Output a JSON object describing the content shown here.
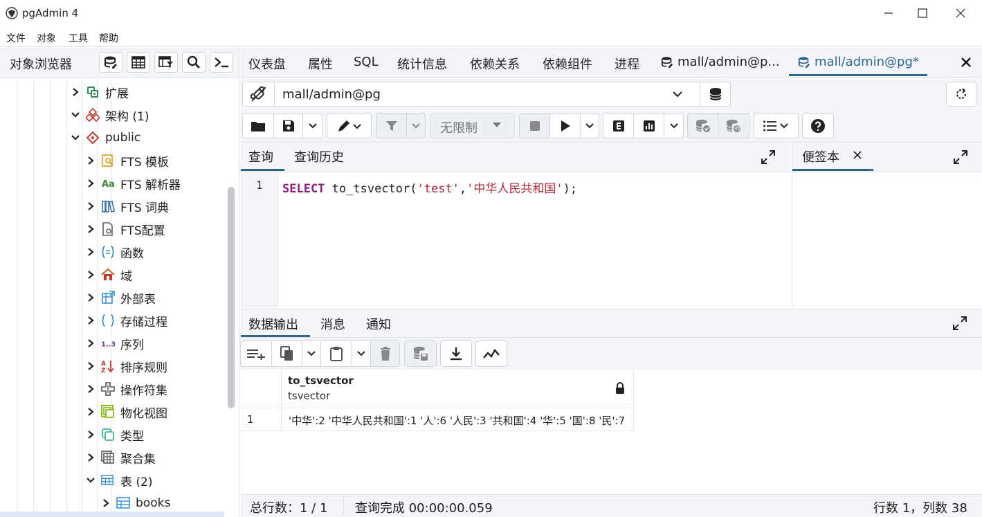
{
  "window": {
    "title": "pgAdmin 4"
  },
  "menu": [
    "文件",
    "对象",
    "工具",
    "帮助"
  ],
  "left_panel": {
    "title": "对象浏览器",
    "tree": [
      {
        "label": "扩展",
        "icon": "extension-icon",
        "expanded": false,
        "level": 0
      },
      {
        "label": "架构 (1)",
        "icon": "schemas-icon",
        "expanded": true,
        "level": 0
      },
      {
        "label": "public",
        "icon": "schema-icon",
        "expanded": true,
        "level": 1
      },
      {
        "label": "FTS 模板",
        "icon": "fts-template-icon",
        "expanded": false,
        "level": 2
      },
      {
        "label": "FTS 解析器",
        "icon": "fts-parser-icon",
        "expanded": false,
        "level": 2
      },
      {
        "label": "FTS 词典",
        "icon": "fts-dictionary-icon",
        "expanded": false,
        "level": 2
      },
      {
        "label": "FTS配置",
        "icon": "fts-configuration-icon",
        "expanded": false,
        "level": 2
      },
      {
        "label": "函数",
        "icon": "function-icon",
        "expanded": false,
        "level": 2
      },
      {
        "label": "域",
        "icon": "domain-icon",
        "expanded": false,
        "level": 2
      },
      {
        "label": "外部表",
        "icon": "foreign-table-icon",
        "expanded": false,
        "level": 2
      },
      {
        "label": "存储过程",
        "icon": "procedure-icon",
        "expanded": false,
        "level": 2
      },
      {
        "label": "序列",
        "icon": "sequence-icon",
        "expanded": false,
        "level": 2
      },
      {
        "label": "排序规则",
        "icon": "collation-icon",
        "expanded": false,
        "level": 2
      },
      {
        "label": "操作符集",
        "icon": "operator-icon",
        "expanded": false,
        "level": 2
      },
      {
        "label": "物化视图",
        "icon": "materialized-view-icon",
        "expanded": false,
        "level": 2
      },
      {
        "label": "类型",
        "icon": "type-icon",
        "expanded": false,
        "level": 2
      },
      {
        "label": "聚合集",
        "icon": "aggregate-icon",
        "expanded": false,
        "level": 2
      },
      {
        "label": "表 (2)",
        "icon": "tables-icon",
        "expanded": true,
        "level": 2
      },
      {
        "label": "books",
        "icon": "table-icon",
        "expanded": false,
        "level": 3
      }
    ],
    "toolbar_icons": [
      "database-icon",
      "table-grid-icon",
      "table-filter-icon",
      "search-icon",
      "terminal-icon"
    ]
  },
  "tabs": [
    {
      "label": "仪表盘"
    },
    {
      "label": "属性"
    },
    {
      "label": "SQL"
    },
    {
      "label": "统计信息"
    },
    {
      "label": "依赖关系"
    },
    {
      "label": "依赖组件"
    },
    {
      "label": "进程"
    },
    {
      "label": "mall/admin@p..."
    },
    {
      "label": "mall/admin@pg*"
    }
  ],
  "connection": {
    "value": "mall/admin@pg"
  },
  "query_toolbar": {
    "limit_label": "无限制"
  },
  "editor": {
    "tabs": [
      "查询",
      "查询历史"
    ],
    "notes_tab": "便签本",
    "line_number": "1",
    "code": {
      "keyword": "SELECT",
      "fn": " to_tsvector(",
      "arg1": "'test'",
      "comma": ",",
      "arg2": "'中华人民共和国'",
      "end": ");"
    }
  },
  "output": {
    "tabs": [
      "数据输出",
      "消息",
      "通知"
    ],
    "columns": [
      {
        "name": "to_tsvector",
        "type": "tsvector"
      }
    ],
    "rows": [
      {
        "row_no": "1",
        "value": "'中华':2 '中华人民共和国':1 '人':6 '人民':3 '共和国':4 '华':5 '国':8 '民':7"
      }
    ]
  },
  "status": {
    "total_rows": "总行数：1 / 1",
    "query_done": "查询完成 00:00:00.059",
    "cursor": "行数 1，列数 38"
  },
  "colors": {
    "accent": "#326690",
    "keyword": "#8e1c7a",
    "string": "#b02a37"
  }
}
